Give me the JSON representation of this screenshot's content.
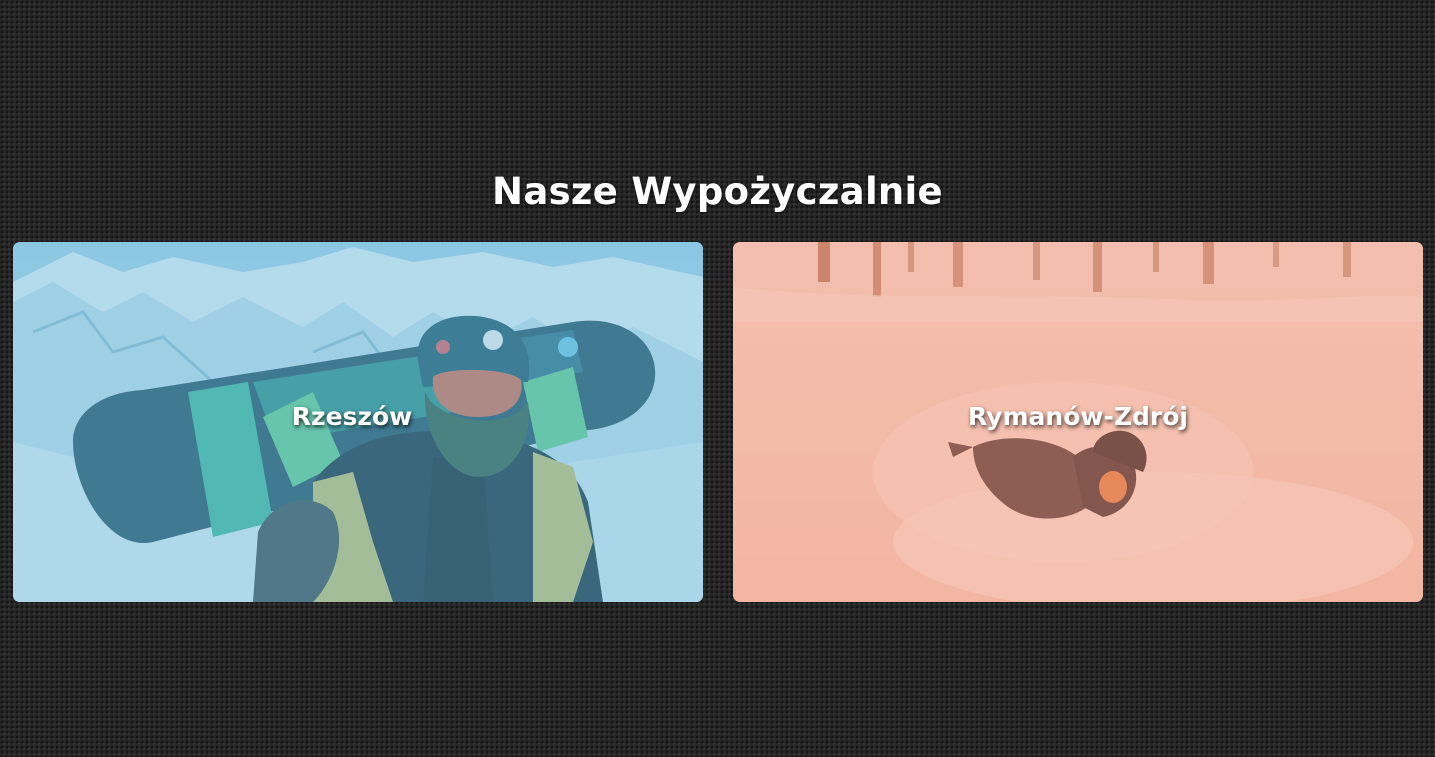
{
  "section": {
    "title": "Nasze Wypożyczalnie"
  },
  "locations": [
    {
      "name": "Rzeszów",
      "overlay_color": "#7fc6e6"
    },
    {
      "name": "Rymanów-Zdrój",
      "overlay_color": "#f2a892"
    }
  ]
}
